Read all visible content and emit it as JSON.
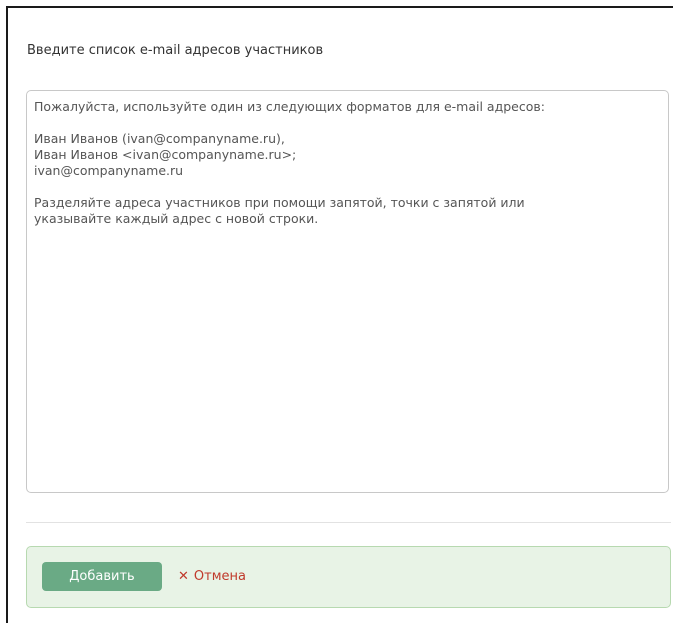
{
  "dialog": {
    "prompt_label": "Введите список e-mail адресов участников",
    "textarea": {
      "placeholder_lines": [
        "Пожалуйста, используйте один из следующих форматов для e-mail адресов:",
        "",
        "Иван Иванов (ivan@companyname.ru),",
        "Иван Иванов <ivan@companyname.ru>;",
        "ivan@companyname.ru",
        "",
        "Разделяйте адреса участников при помощи запятой, точки с запятой или",
        "указывайте каждый адрес с новой строки."
      ]
    },
    "footer": {
      "add_label": "Добавить",
      "cancel_icon": "close-icon",
      "cancel_label": "Отмена"
    }
  },
  "colors": {
    "add_button_bg": "#6aaa85",
    "footer_bg": "#e8f3e6",
    "cancel_text": "#c0392b"
  }
}
